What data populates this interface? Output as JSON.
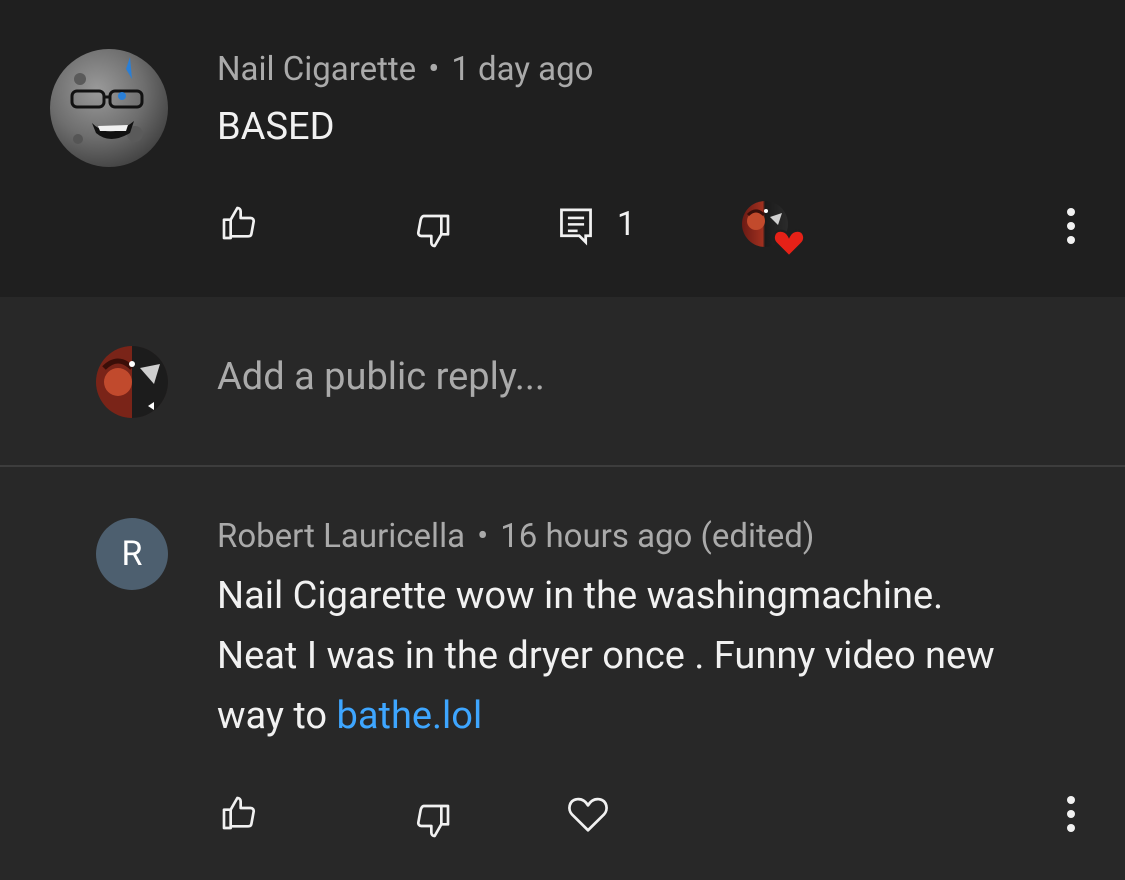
{
  "comment": {
    "author": "Nail Cigarette",
    "separator": "•",
    "time": "1 day ago",
    "text": "BASED",
    "reply_count": "1"
  },
  "reply_input": {
    "placeholder": "Add a public reply..."
  },
  "reply": {
    "avatar_initial": "R",
    "author": "Robert Lauricella",
    "separator": "•",
    "time": "16 hours ago (edited)",
    "line1": "Nail Cigarette wow in the washingmachine.",
    "line2": "Neat I was in the dryer once . Funny video new",
    "line3_prefix": "way to ",
    "line3_link": "bathe.lol"
  },
  "colors": {
    "main_bg": "#1f1f1f",
    "reply_bg": "#282828",
    "text": "#f1f1f1",
    "meta": "#aaaaaa",
    "link": "#3ea6ff",
    "heart": "#e62117",
    "avatar_r": "#4d5f6f"
  },
  "icons": [
    "like-icon",
    "dislike-icon",
    "reply-icon",
    "creator-heart-icon",
    "more-vert-icon",
    "heart-outline-icon"
  ]
}
